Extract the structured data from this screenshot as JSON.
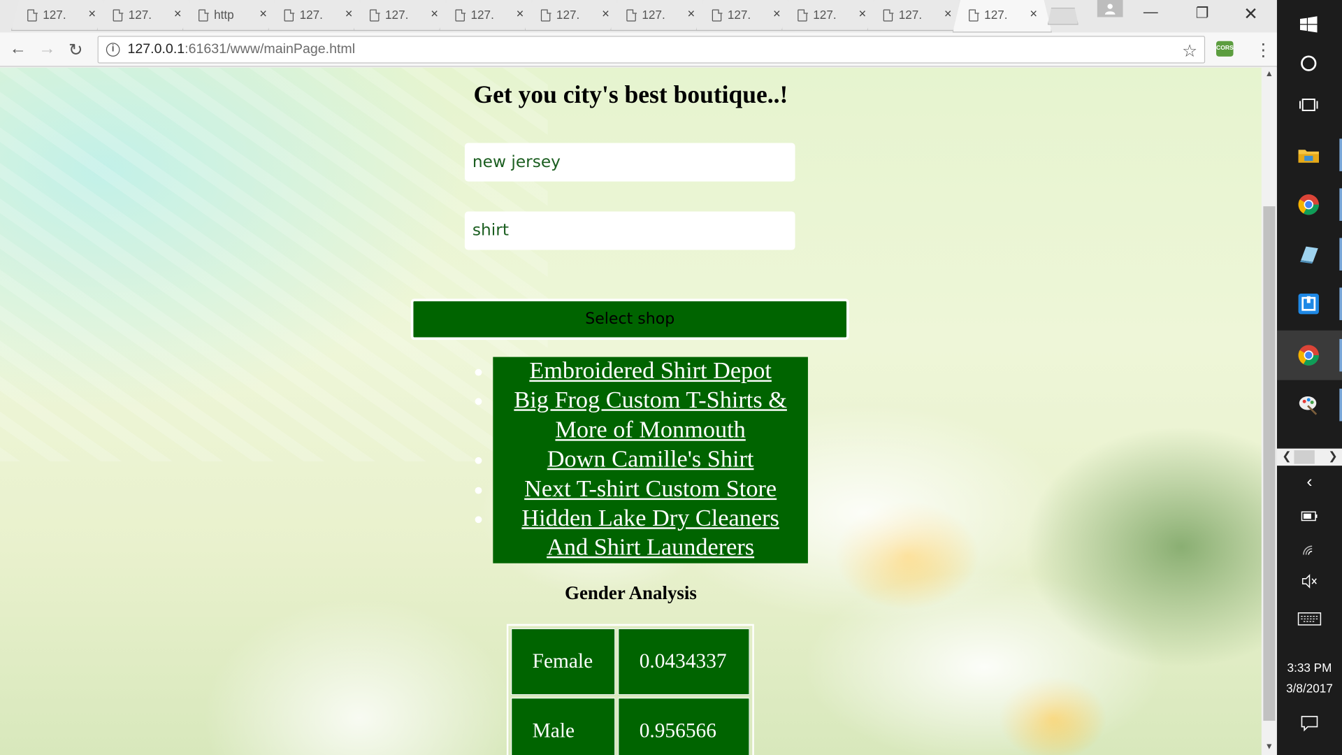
{
  "browser": {
    "tabs": [
      {
        "title": "127."
      },
      {
        "title": "127."
      },
      {
        "title": "http"
      },
      {
        "title": "127."
      },
      {
        "title": "127."
      },
      {
        "title": "127."
      },
      {
        "title": "127."
      },
      {
        "title": "127."
      },
      {
        "title": "127."
      },
      {
        "title": "127."
      },
      {
        "title": "127."
      },
      {
        "title": "127.",
        "active": true
      }
    ],
    "close_glyph": "×",
    "url_host": "127.0.0.1",
    "url_rest": ":61631/www/mainPage.html",
    "extension_label": "CORS"
  },
  "page": {
    "heading": "Get you city's best boutique..!",
    "city_value": "new jersey",
    "item_value": "shirt",
    "select_button": "Select shop",
    "shops": [
      "Embroidered Shirt Depot",
      "Big Frog Custom T-Shirts & More of Monmouth",
      "Down Camille's Shirt",
      "Next T-shirt Custom Store",
      "Hidden Lake Dry Cleaners And Shirt Launderers"
    ],
    "gender_title": "Gender Analysis",
    "gender_rows": [
      {
        "label": "Female",
        "value": "0.0434337"
      },
      {
        "label": "Male",
        "value": "0.956566"
      }
    ]
  },
  "colors": {
    "accent_green": "#006400",
    "input_text": "#1b5e20"
  },
  "taskbar": {
    "time": "3:33 PM",
    "date": "3/8/2017",
    "items": [
      "start-icon",
      "cortana-icon",
      "task-view-icon",
      "file-explorer-icon",
      "chrome-icon",
      "app-icon",
      "app-square-icon",
      "chrome-active-icon",
      "paint-icon"
    ]
  }
}
